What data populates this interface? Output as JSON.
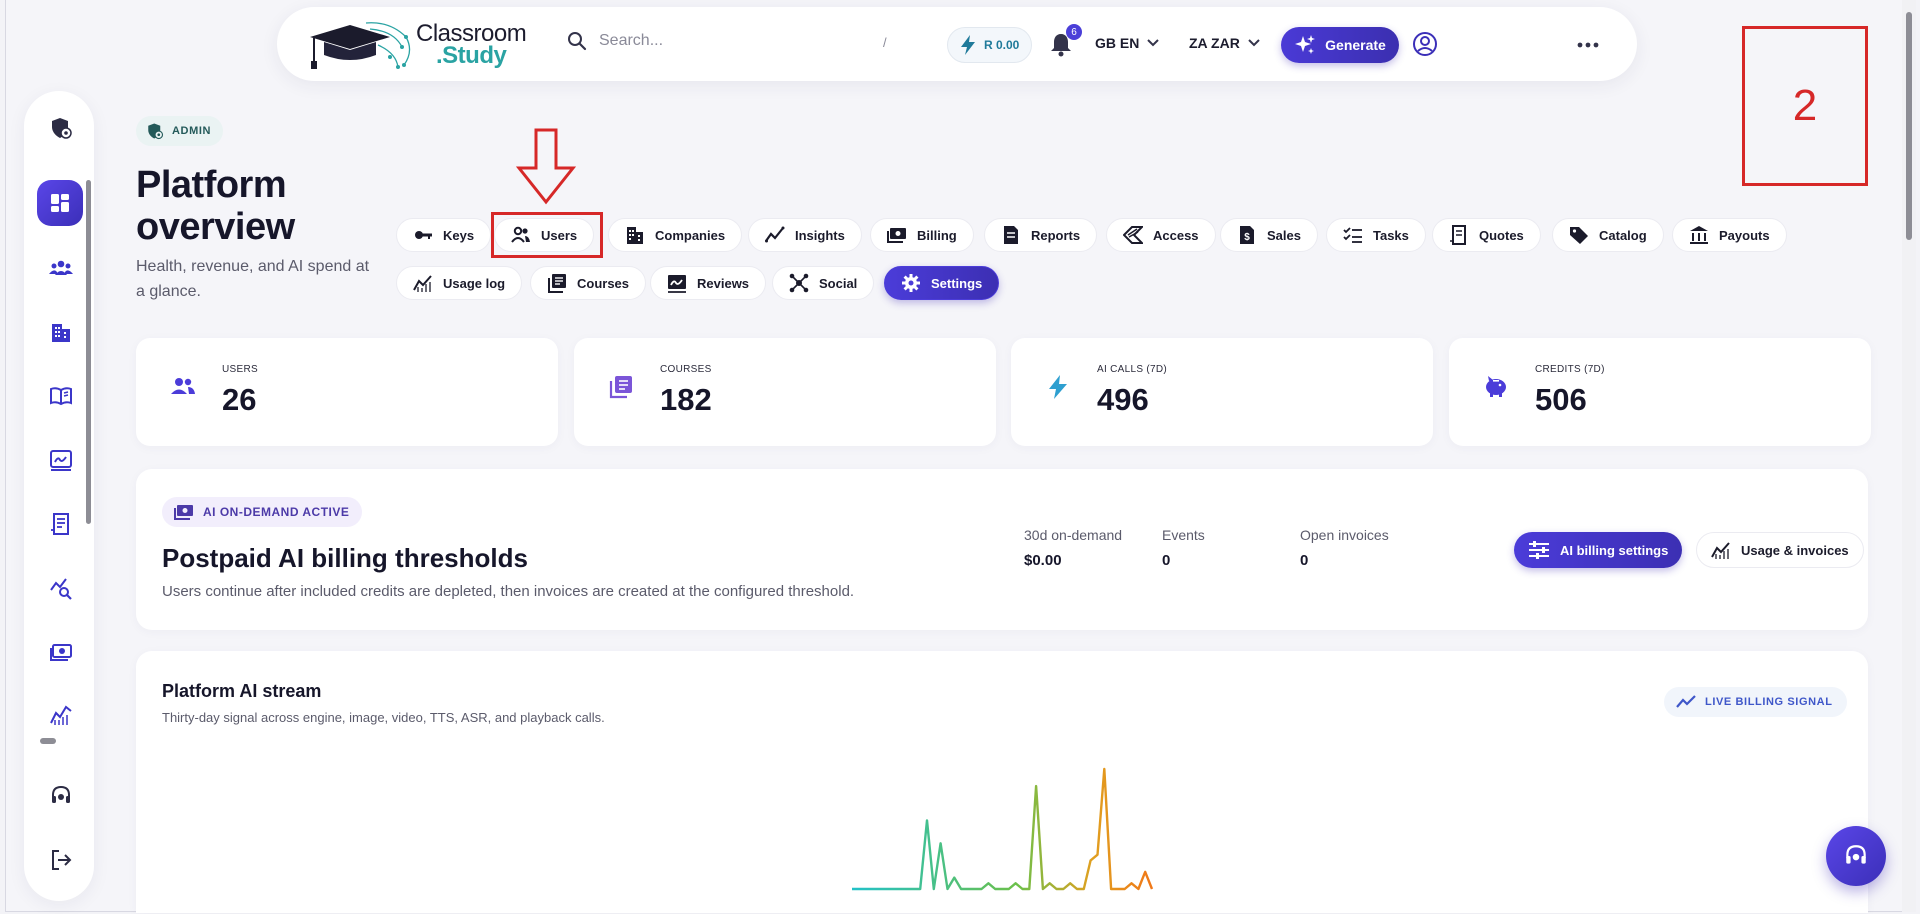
{
  "brand": {
    "line1": "Classroom",
    "line2": ".Study"
  },
  "search": {
    "placeholder": "Search...",
    "shortcut": "/"
  },
  "header": {
    "credit_balance": "R 0.00",
    "notification_count": "6",
    "language": "GB EN",
    "currency": "ZA ZAR",
    "generate_label": "Generate"
  },
  "step_marker": "2",
  "page": {
    "badge": "ADMIN",
    "title": "Platform overview",
    "subtitle": "Health, revenue, and AI spend at a glance."
  },
  "tabs": [
    {
      "label": "Keys",
      "icon": "key-icon"
    },
    {
      "label": "Users",
      "icon": "users-icon"
    },
    {
      "label": "Companies",
      "icon": "building-icon"
    },
    {
      "label": "Insights",
      "icon": "insights-icon"
    },
    {
      "label": "Billing",
      "icon": "cash-icon"
    },
    {
      "label": "Reports",
      "icon": "report-icon"
    },
    {
      "label": "Access",
      "icon": "access-icon"
    },
    {
      "label": "Sales",
      "icon": "invoice-icon"
    },
    {
      "label": "Tasks",
      "icon": "checklist-icon"
    },
    {
      "label": "Quotes",
      "icon": "receipt-icon"
    },
    {
      "label": "Catalog",
      "icon": "tag-icon"
    },
    {
      "label": "Payouts",
      "icon": "bank-icon"
    },
    {
      "label": "Usage log",
      "icon": "chart-icon"
    },
    {
      "label": "Courses",
      "icon": "library-icon"
    },
    {
      "label": "Reviews",
      "icon": "review-icon"
    },
    {
      "label": "Social",
      "icon": "network-icon"
    },
    {
      "label": "Settings",
      "icon": "gear-icon",
      "active": true
    }
  ],
  "stats": [
    {
      "label": "USERS",
      "value": "26",
      "icon": "users-icon"
    },
    {
      "label": "COURSES",
      "value": "182",
      "icon": "library-icon"
    },
    {
      "label": "AI CALLS (7D)",
      "value": "496",
      "icon": "bolt-icon"
    },
    {
      "label": "CREDITS (7D)",
      "value": "506",
      "icon": "piggy-bank-icon"
    }
  ],
  "billing": {
    "badge": "AI ON-DEMAND ACTIVE",
    "title": "Postpaid AI billing thresholds",
    "description": "Users continue after included credits are depleted, then invoices are created at the configured threshold.",
    "metrics": [
      {
        "label": "30d on-demand",
        "value": "$0.00"
      },
      {
        "label": "Events",
        "value": "0"
      },
      {
        "label": "Open invoices",
        "value": "0"
      }
    ],
    "primary_button": "AI billing settings",
    "secondary_button": "Usage & invoices"
  },
  "stream": {
    "title": "Platform AI stream",
    "subtitle": "Thirty-day signal across engine, image, video, TTS, ASR, and playback calls.",
    "badge": "LIVE BILLING SIGNAL"
  },
  "colors": {
    "accent": "#4b3cd9",
    "annotation": "#d62828",
    "teal": "#2aa3a3"
  },
  "chart_data": {
    "type": "line",
    "title": "",
    "xlabel": "",
    "ylabel": "",
    "series": [
      {
        "values": [
          0,
          0,
          0,
          0,
          0,
          0,
          0,
          0,
          0,
          0,
          0,
          12,
          0,
          8,
          0,
          2,
          0,
          0,
          0,
          0,
          1,
          0,
          0,
          0,
          1,
          0,
          0,
          18,
          0,
          1,
          0,
          0,
          1,
          0,
          0,
          5,
          6,
          21,
          0,
          0,
          0,
          1,
          0,
          3,
          0
        ]
      }
    ],
    "color_gradient": [
      "#22c1c8",
      "#6cc04a",
      "#e0a020",
      "#f07818"
    ]
  }
}
